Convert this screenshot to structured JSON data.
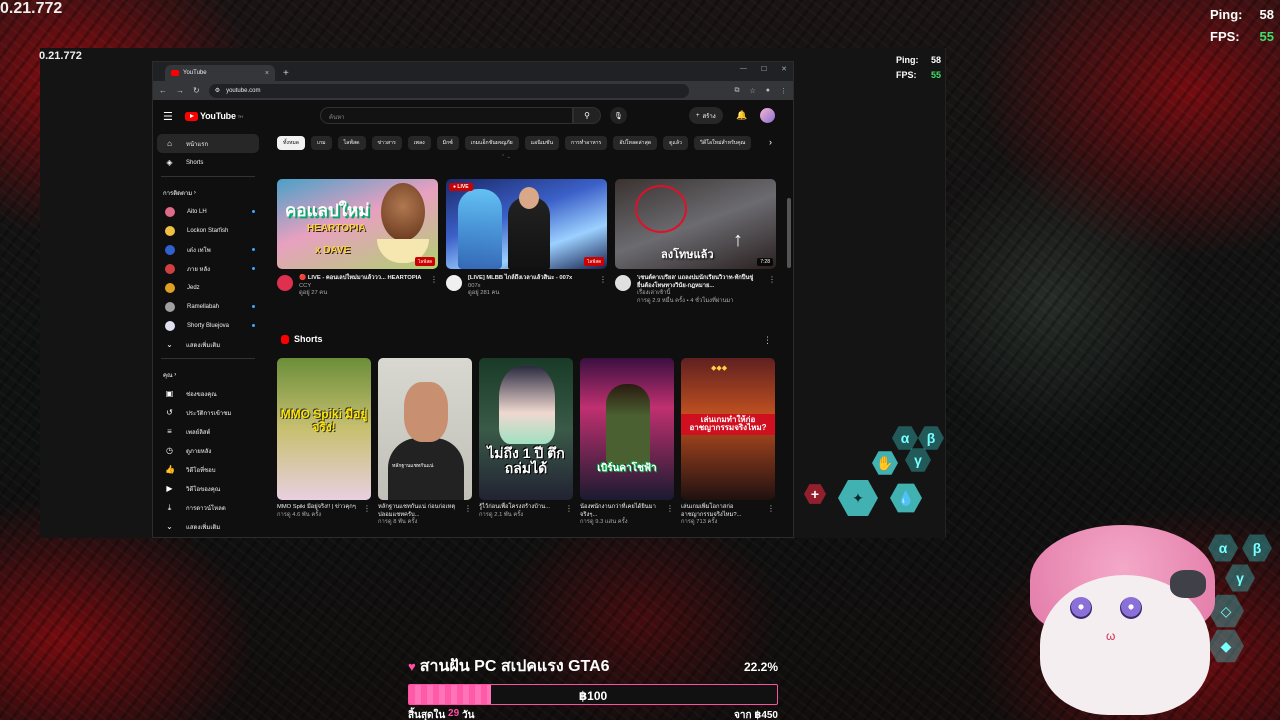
{
  "overlay": {
    "timer": "0.21.772",
    "ping_label": "Ping:",
    "ping_value": "58",
    "fps_label": "FPS:",
    "fps_value": "55"
  },
  "browser": {
    "tab_title": "YouTube",
    "tab_close": "×",
    "new_tab": "+",
    "url": "youtube.com"
  },
  "youtube": {
    "logo_text": "YouTube",
    "logo_sup": "TH",
    "search_placeholder": "ค้นหา",
    "create_label": "สร้าง",
    "sidebar": {
      "main": [
        {
          "label": "หน้าแรก",
          "icon": "home-icon"
        },
        {
          "label": "Shorts",
          "icon": "shorts-icon"
        }
      ],
      "subs_heading": "การติดตาม",
      "subscriptions": [
        {
          "label": "Aito LH",
          "color": "#e06a8a",
          "live": true
        },
        {
          "label": "Lockon Starfish",
          "color": "#f0c040",
          "live": false
        },
        {
          "label": "เต๋ง เทโพ",
          "color": "#3060d0",
          "live": true
        },
        {
          "label": "ภาย หลัง",
          "color": "#d04040",
          "live": true
        },
        {
          "label": "Jedz",
          "color": "#e0a020",
          "live": false
        },
        {
          "label": "Ramellabah",
          "color": "#a0a0a0",
          "live": true
        },
        {
          "label": "Shorty Bluejova",
          "color": "#e0e0f0",
          "live": true
        }
      ],
      "show_more": "แสดงเพิ่มเติม",
      "you_heading": "คุณ",
      "you_items": [
        {
          "label": "ช่องของคุณ",
          "icon": "account-box-icon"
        },
        {
          "label": "ประวัติการเข้าชม",
          "icon": "history-icon"
        },
        {
          "label": "เพลย์ลิสต์",
          "icon": "playlist-icon"
        },
        {
          "label": "ดูภายหลัง",
          "icon": "clock-icon"
        },
        {
          "label": "วิดีโอที่ชอบ",
          "icon": "thumbs-up-icon"
        },
        {
          "label": "วิดีโอของคุณ",
          "icon": "video-icon"
        },
        {
          "label": "การดาวน์โหลด",
          "icon": "download-icon"
        },
        {
          "label": "แสดงเพิ่มเติม",
          "icon": "chevron-down-icon"
        }
      ]
    },
    "chips": [
      "ทั้งหมด",
      "เกม",
      "ไลฟ์สด",
      "ข่าวสาร",
      "เพลง",
      "มิกซ์",
      "เกมแอ็กชันผจญภัย",
      "แอนิเมชัน",
      "การทำอาหาร",
      "อัปโหลดล่าสุด",
      "ดูแล้ว",
      "วิดีโอใหม่สำหรับคุณ"
    ],
    "videos": [
      {
        "thumb_text": "คอแลปใหม่",
        "thumb_text2": "HEARTOPIA",
        "thumb_text3": "x DAVE",
        "badge": "ไลฟ์สด",
        "channel_color": "#e03050",
        "title": "🔴 LIVE - คอนเลปใหม่มาแล้ววว... HEARTOPIA",
        "channel": "CCY",
        "stats": "ดูอยู่ 27 คน"
      },
      {
        "live_label": "● LIVE",
        "badge": "ไลฟ์สด",
        "channel_color": "#f0f0f0",
        "title": "[LIVE] MLBB ไกล์ถึงเวลาแล้วสินะ - 007x",
        "channel": "007x",
        "stats": "ดูอยู่ 281 คน"
      },
      {
        "thumb_text": "ลงโทษแล้ว",
        "duration": "7:28",
        "channel_color": "#e0e0e0",
        "title": "'เซนต์คาเบรียล' แถลงปมนักเรียนวิวาท-ทักปืนขู่ ยื่นต้องโทษทางวินัย-กฎหมาย...",
        "channel": "เรื่องเล่าเช้านี้",
        "stats": "การดู 2.9 หมื่น ครั้ง • 4 ชั่วโมงที่ผ่านมา"
      }
    ],
    "shorts_heading": "Shorts",
    "shorts": [
      {
        "caption": "MMO Spiki มีอยู่จริง!",
        "title": "MMO Spiki มีอยู่จริง!! | ข่าวคุกๆ",
        "views": "การดู 4.6 พัน ครั้ง"
      },
      {
        "caption": "หลักฐานแชทกันแน่",
        "title": "หลักฐานแชทกันแน่ ก่อนก่อเหตุ ปลอมแชทครับ...",
        "views": "การดู 8 พัน ครั้ง"
      },
      {
        "caption": "ไม่ถึง 1 ปี ตึกถล่มได้",
        "title": "รู้ไว้ก่อนเพื่อโครงสร้างบ้าน...",
        "views": "การดู 2.1 พัน ครั้ง"
      },
      {
        "caption": "เบิร์นคาโชฟ้า",
        "title": "น้องพนักงานกว่าที่เคยได้ยินมาจริงๆ...",
        "views": "การดู 9.3 แสน ครั้ง"
      },
      {
        "caption": "เล่นเกมทำให้ก่ออาชญากรรมจริงไหม?",
        "title": "เล่นเกมเพิ่มโอกาสก่ออาชญากรรมจริงไหม?...",
        "views": "การดู 713 ครั้ง"
      }
    ]
  },
  "donation": {
    "heart": "♥",
    "title": "สานฝัน PC สเปคแรง GTA6",
    "percent": "22.2%",
    "progress": 0.222,
    "current": "฿100",
    "ends_prefix": "สิ้นสุดใน",
    "days": "29",
    "days_suffix": "วัน",
    "target": "จาก ฿450"
  },
  "hex_letters": [
    "α",
    "β",
    "γ"
  ]
}
